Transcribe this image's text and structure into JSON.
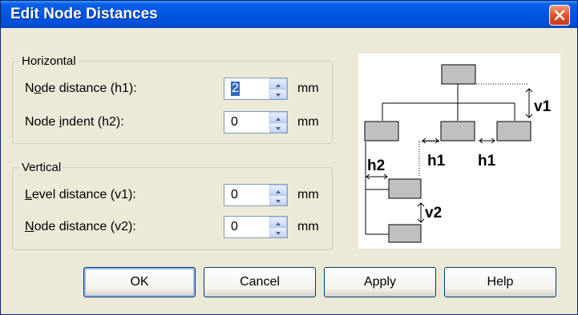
{
  "dialog": {
    "title": "Edit Node Distances"
  },
  "horizontal": {
    "legend": "Horizontal",
    "node_distance": {
      "label_pre": "N",
      "label_u": "o",
      "label_post": "de distance (h1):",
      "value": "2",
      "unit": "mm"
    },
    "node_indent": {
      "label_pre": "Node ",
      "label_u": "i",
      "label_post": "ndent (h2):",
      "value": "0",
      "unit": "mm"
    }
  },
  "vertical": {
    "legend": "Vertical",
    "level_distance": {
      "label_pre": "",
      "label_u": "L",
      "label_post": "evel distance (v1):",
      "value": "0",
      "unit": "mm"
    },
    "node_distance": {
      "label_pre": "",
      "label_u": "N",
      "label_post": "ode distance (v2):",
      "value": "0",
      "unit": "mm"
    }
  },
  "diagram": {
    "labels": {
      "v1": "v1",
      "h1_a": "h1",
      "h1_b": "h1",
      "h2": "h2",
      "v2": "v2"
    }
  },
  "buttons": {
    "ok": "OK",
    "cancel": "Cancel",
    "apply": "Apply",
    "help": "Help"
  },
  "colors": {
    "titlebar": "#0054e3",
    "face": "#ece9d8",
    "node_fill": "#c0c0c0",
    "close": "#e2572f"
  },
  "icons": {
    "close": "close-icon",
    "spin_up": "triangle-up-icon",
    "spin_down": "triangle-down-icon"
  }
}
